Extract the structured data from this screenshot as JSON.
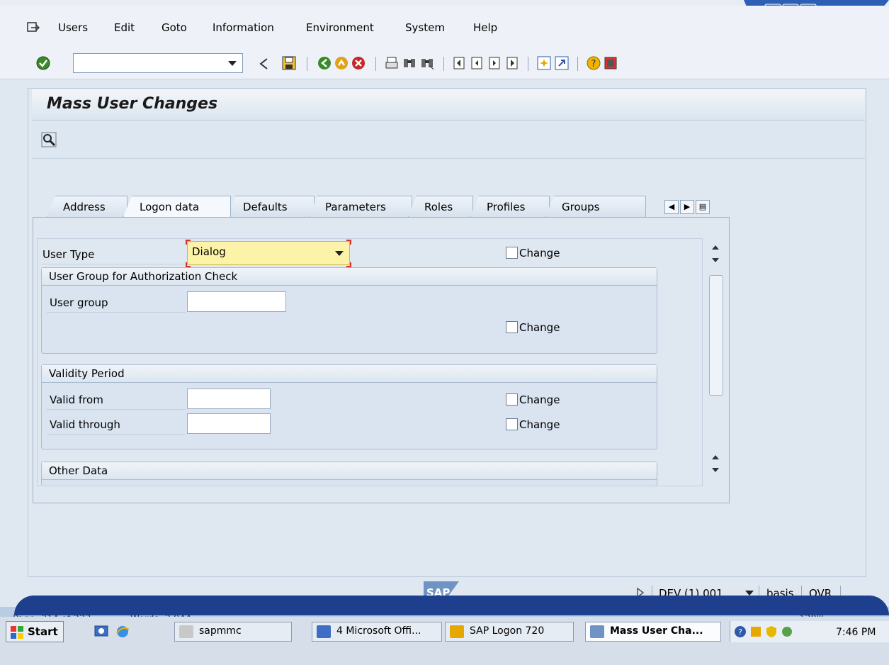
{
  "window": {
    "controls": [
      "minimize-icon",
      "maximize-icon",
      "close-icon"
    ]
  },
  "menu": [
    {
      "label": "Users",
      "icon": "menu-icon"
    },
    {
      "label": "Edit"
    },
    {
      "label": "Goto"
    },
    {
      "label": "Information"
    },
    {
      "label": "Environment"
    },
    {
      "label": "System"
    },
    {
      "label": "Help"
    }
  ],
  "toolbar": {
    "command_value": "",
    "icons": [
      "enter-icon",
      "back-arrow-icon",
      "save-icon",
      "back-icon",
      "exit-icon",
      "cancel-icon",
      "print-icon",
      "find-icon",
      "find-next-icon",
      "first-page-icon",
      "previous-page-icon",
      "next-page-icon",
      "last-page-icon",
      "create-session-icon",
      "shortcut-icon",
      "help-icon",
      "layout-icon"
    ]
  },
  "page": {
    "title": "Mass User Changes"
  },
  "tabs": [
    {
      "label": "Address",
      "active": false
    },
    {
      "label": "Logon data",
      "active": true
    },
    {
      "label": "Defaults",
      "active": false
    },
    {
      "label": "Parameters",
      "active": false
    },
    {
      "label": "Roles",
      "active": false
    },
    {
      "label": "Profiles",
      "active": false
    },
    {
      "label": "Groups",
      "active": false
    }
  ],
  "form": {
    "user_type": {
      "label": "User Type",
      "value": "Dialog",
      "change_label": "Change"
    },
    "auth_group": {
      "title": "User Group for Authorization Check",
      "user_group_label": "User group",
      "user_group_value": "",
      "change_label": "Change"
    },
    "validity": {
      "title": "Validity Period",
      "valid_from_label": "Valid from",
      "valid_from_value": "",
      "valid_through_label": "Valid through",
      "valid_through_value": "",
      "change_label": "Change"
    },
    "other": {
      "title": "Other Data"
    }
  },
  "status": {
    "logo": "SAP",
    "system": "DEV (1) 001",
    "user": "basis",
    "mode": "OVR"
  },
  "word_status": {
    "page": "Page: 214 of 223",
    "words": "Words: 2,944",
    "zoom": "120%"
  },
  "taskbar": {
    "start": "Start",
    "tasks": [
      {
        "label": "sapmmc",
        "active": false
      },
      {
        "label": "4 Microsoft Offi...",
        "active": false
      },
      {
        "label": "SAP Logon 720",
        "active": false
      },
      {
        "label": "Mass User Cha...",
        "active": true
      }
    ],
    "time": "7:46 PM"
  },
  "colors": {
    "accent_yellow": "#fdf3a8",
    "focus_red": "#d0312d",
    "taskbar_blue": "#1d3f8e"
  }
}
